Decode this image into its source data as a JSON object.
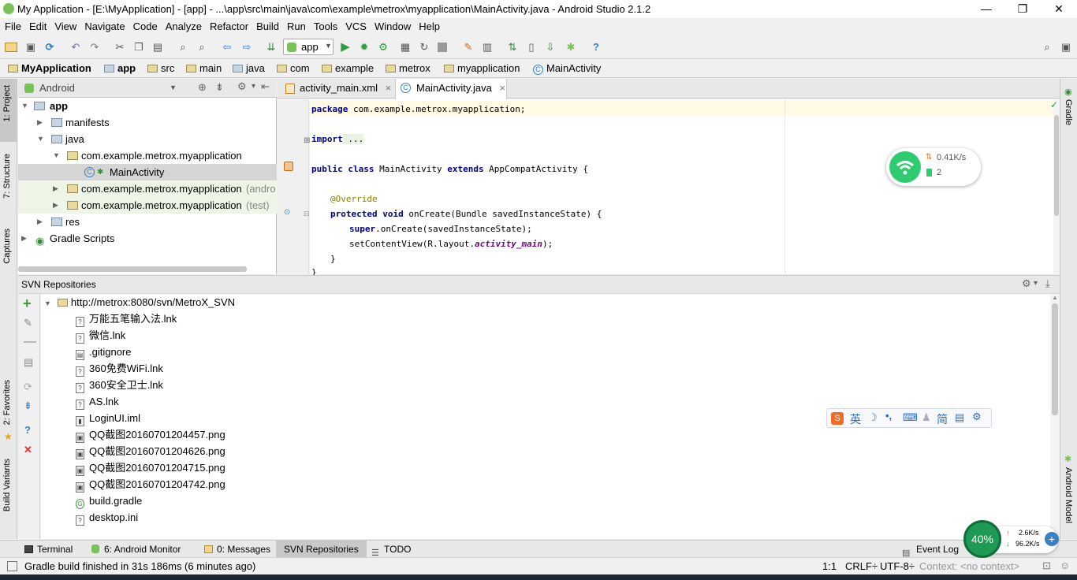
{
  "window": {
    "title": "My Application - [E:\\MyApplication] - [app] - ...\\app\\src\\main\\java\\com\\example\\metrox\\myapplication\\MainActivity.java - Android Studio 2.1.2",
    "minimize": "—",
    "restore": "❐",
    "close": "✕"
  },
  "menu": [
    "File",
    "Edit",
    "View",
    "Navigate",
    "Code",
    "Analyze",
    "Refactor",
    "Build",
    "Run",
    "Tools",
    "VCS",
    "Window",
    "Help"
  ],
  "toolbar": {
    "run_config": "app"
  },
  "breadcrumbs": [
    "MyApplication",
    "app",
    "src",
    "main",
    "java",
    "com",
    "example",
    "metrox",
    "myapplication",
    "MainActivity"
  ],
  "left_tabs": [
    "1: Project",
    "7: Structure",
    "Captures",
    "2: Favorites",
    "Build Variants"
  ],
  "right_tabs": [
    "Gradle",
    "Android Model"
  ],
  "project": {
    "view": "Android",
    "tree": [
      {
        "label": "app",
        "bold": true,
        "level": 0,
        "arrow": "▼"
      },
      {
        "label": "manifests",
        "level": 1,
        "arrow": "▶"
      },
      {
        "label": "java",
        "level": 1,
        "arrow": "▼"
      },
      {
        "label": "com.example.metrox.myapplication",
        "level": 2,
        "arrow": "▼"
      },
      {
        "label": "MainActivity",
        "level": 3,
        "arrow": "",
        "selected": true
      },
      {
        "label": "com.example.metrox.myapplication",
        "suffix": "(andro",
        "level": 2,
        "arrow": "▶"
      },
      {
        "label": "com.example.metrox.myapplication",
        "suffix": "(test)",
        "level": 2,
        "arrow": "▶"
      },
      {
        "label": "res",
        "level": 1,
        "arrow": "▶"
      },
      {
        "label": "Gradle Scripts",
        "level": 0,
        "arrow": "▶"
      }
    ]
  },
  "editor": {
    "tabs": [
      {
        "label": "activity_main.xml",
        "close": "×"
      },
      {
        "label": "MainActivity.java",
        "close": "×",
        "active": true
      }
    ],
    "code": {
      "l1_kw": "package",
      "l1_rest": " com.example.metrox.myapplication;",
      "l2_kw": "import",
      "l2_rest": " ...",
      "l3_kw1": "public class",
      "l3_mid": " MainActivity ",
      "l3_kw2": "extends",
      "l3_rest": " AppCompatActivity {",
      "l4": "@Override",
      "l5_kw": "protected void",
      "l5_rest": " onCreate(Bundle savedInstanceState) {",
      "l6_kw": "super",
      "l6_rest": ".onCreate(savedInstanceState);",
      "l7_a": "setContentView(R.layout.",
      "l7_fld": "activity_main",
      "l7_b": ");",
      "l8": "}",
      "l9": "}"
    }
  },
  "svn": {
    "title": "SVN Repositories",
    "root": "http://metrox:8080/svn/MetroX_SVN",
    "files": [
      "万能五笔输入法.lnk",
      "微信.lnk",
      ".gitignore",
      "360免费WiFi.lnk",
      "360安全卫士.lnk",
      "AS.lnk",
      "LoginUI.iml",
      "QQ截图20160701204457.png",
      "QQ截图20160701204626.png",
      "QQ截图20160701204715.png",
      "QQ截图20160701204742.png",
      "build.gradle",
      "desktop.ini"
    ]
  },
  "bottom_tabs": {
    "terminal": "Terminal",
    "monitor": "6: Android Monitor",
    "messages": "0: Messages",
    "svn": "SVN Repositories",
    "todo": "TODO",
    "eventlog": "Event Log"
  },
  "status": {
    "message": "Gradle build finished in 31s 186ms (6 minutes ago)",
    "position": "1:1",
    "line_sep": "CRLF÷",
    "encoding": "UTF-8÷",
    "context": "Context: <no context>"
  },
  "net_widget": {
    "speed": "0.41K/s",
    "devices": "2"
  },
  "ime": {
    "lang": "英",
    "punct": "•,",
    "mode": "简"
  },
  "meter": {
    "percent": "40%",
    "up": "2.6K/s",
    "down": "96.2K/s"
  },
  "colors": {
    "accent_green": "#499c54",
    "selection": "#d5d5d5",
    "vcs_green_bg": "#eef5e6",
    "caret_line": "#fffae3",
    "net_green": "#2ecc71"
  }
}
